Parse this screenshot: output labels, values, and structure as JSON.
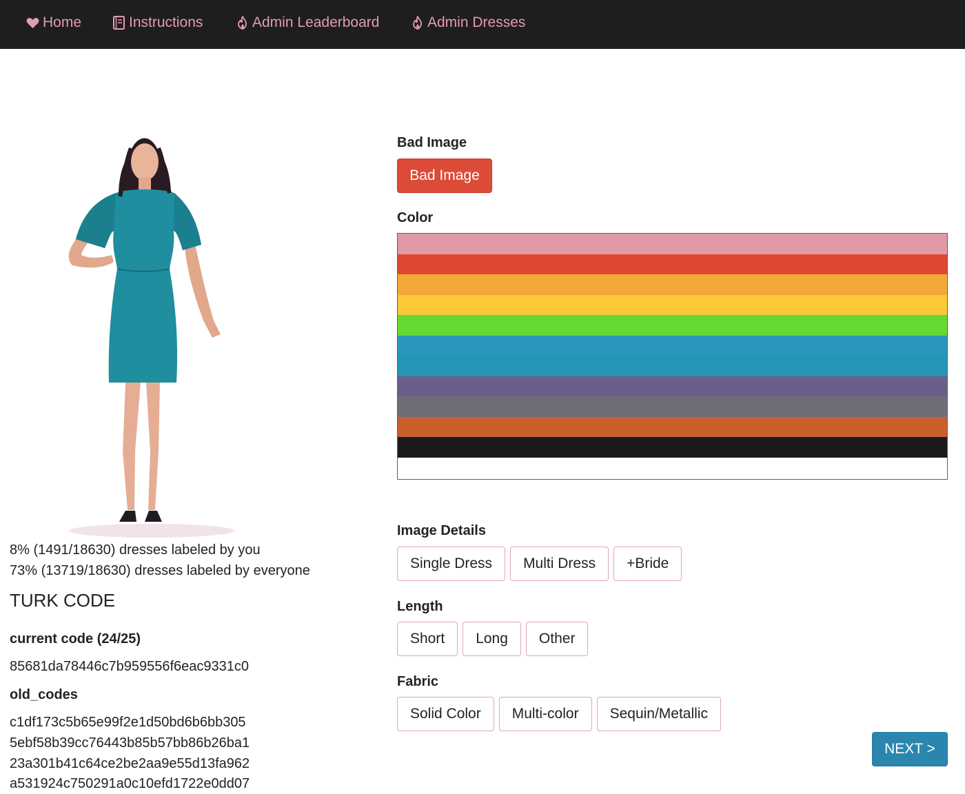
{
  "nav": {
    "home": "Home",
    "instructions": "Instructions",
    "admin_leaderboard": "Admin Leaderboard",
    "admin_dresses": "Admin Dresses",
    "text_color": "#e49ab8",
    "bg_color": "#1e1e1e"
  },
  "stats": {
    "by_you": "8% (1491/18630) dresses labeled by you",
    "by_everyone": "73% (13719/18630) dresses labeled by everyone"
  },
  "turk": {
    "title": "TURK CODE",
    "current_label": "current code (24/25)",
    "current_code": "85681da78446c7b959556f6eac9331c0",
    "old_label": "old_codes",
    "old_codes": [
      "c1df173c5b65e99f2e1d50bd6b6bb305",
      "5ebf58b39cc76443b85b57bb86b26ba1",
      "23a301b41c64ce2be2aa9e55d13fa962",
      "a531924c750291a0c10efd1722e0dd07"
    ]
  },
  "bad_image": {
    "section": "Bad Image",
    "button": "Bad Image",
    "color": "#dc4b38"
  },
  "color": {
    "section": "Color",
    "swatches": [
      {
        "name": "pink",
        "hex": "#e09aa6"
      },
      {
        "name": "red",
        "hex": "#dc4832"
      },
      {
        "name": "orange",
        "hex": "#f3a83a"
      },
      {
        "name": "yellow",
        "hex": "#fcc835"
      },
      {
        "name": "green",
        "hex": "#66d932"
      },
      {
        "name": "blue",
        "hex": "#2996bc"
      },
      {
        "name": "teal",
        "hex": "#2596b6"
      },
      {
        "name": "purple",
        "hex": "#6c5e8a"
      },
      {
        "name": "gray",
        "hex": "#6f6d78"
      },
      {
        "name": "brown",
        "hex": "#c9602c"
      },
      {
        "name": "black",
        "hex": "#1c1a1c"
      },
      {
        "name": "white",
        "hex": "#ffffff"
      }
    ]
  },
  "image_details": {
    "section": "Image Details",
    "options": [
      "Single Dress",
      "Multi Dress",
      "+Bride"
    ]
  },
  "length": {
    "section": "Length",
    "options": [
      "Short",
      "Long",
      "Other"
    ]
  },
  "fabric": {
    "section": "Fabric",
    "options": [
      "Solid Color",
      "Multi-color",
      "Sequin/Metallic"
    ]
  },
  "next": {
    "label": "NEXT >",
    "color": "#2b86ae"
  }
}
